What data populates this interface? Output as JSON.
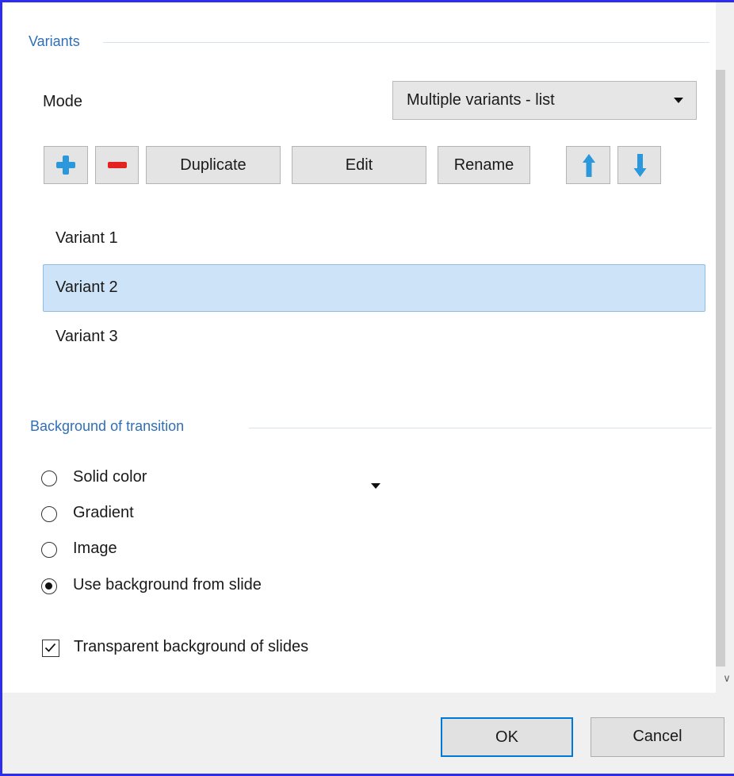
{
  "variants_section": {
    "title": "Variants",
    "mode_label": "Mode",
    "mode_value": "Multiple variants - list"
  },
  "toolbar": {
    "add_icon": "plus-icon",
    "remove_icon": "minus-icon",
    "duplicate_label": "Duplicate",
    "edit_label": "Edit",
    "rename_label": "Rename",
    "move_up_icon": "arrow-up-icon",
    "move_down_icon": "arrow-down-icon"
  },
  "variants_list": {
    "items": [
      {
        "label": "Variant 1",
        "selected": false
      },
      {
        "label": "Variant 2",
        "selected": true
      },
      {
        "label": "Variant 3",
        "selected": false
      }
    ]
  },
  "background_section": {
    "title": "Background of transition",
    "options": [
      {
        "label": "Solid color",
        "checked": false
      },
      {
        "label": "Gradient",
        "checked": false
      },
      {
        "label": "Image",
        "checked": false
      },
      {
        "label": "Use background from slide",
        "checked": true
      }
    ],
    "transparent_label": "Transparent background of slides",
    "transparent_checked": true
  },
  "footer": {
    "ok_label": "OK",
    "cancel_label": "Cancel"
  },
  "colors": {
    "accent": "#2f6fb8",
    "selection_bg": "#cde3f7",
    "plus_blue": "#2b98dc",
    "minus_red": "#e52222",
    "window_border": "#2d2df0"
  }
}
